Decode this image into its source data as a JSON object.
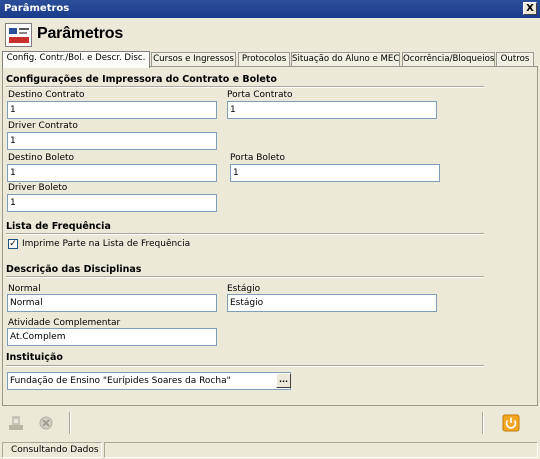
{
  "window": {
    "title": "Parâmetros",
    "close_label": "X"
  },
  "header": {
    "title": "Parâmetros"
  },
  "tabs": [
    {
      "label": "Config. Contr./Bol. e Descr. Disc."
    },
    {
      "label": "Cursos e Ingressos"
    },
    {
      "label": "Protocolos"
    },
    {
      "label": "Situação do Aluno e MEC"
    },
    {
      "label": "Ocorrência/Bloqueios"
    },
    {
      "label": "Outros"
    }
  ],
  "printer": {
    "section_title": "Configurações de Impressora do Contrato e Boleto",
    "destino_contrato": {
      "label": "Destino Contrato",
      "value": "1"
    },
    "porta_contrato": {
      "label": "Porta Contrato",
      "value": "1"
    },
    "driver_contrato": {
      "label": "Driver Contrato",
      "value": "1"
    },
    "destino_boleto": {
      "label": "Destino Boleto",
      "value": "1"
    },
    "porta_boleto": {
      "label": "Porta Boleto",
      "value": "1"
    },
    "driver_boleto": {
      "label": "Driver Boleto",
      "value": "1"
    }
  },
  "frequencia": {
    "section_title": "Lista de Frequência",
    "checkbox_label": "Imprime Parte na Lista de Frequência",
    "checkbox_mark": "✓"
  },
  "disciplinas": {
    "section_title": "Descrição das Disciplinas",
    "normal": {
      "label": "Normal",
      "value": "Normal"
    },
    "estagio": {
      "label": "Estágio",
      "value": "Estágio"
    },
    "atividade": {
      "label": "Atividade Complementar",
      "value": "At.Complem"
    }
  },
  "instituicao": {
    "section_title": "Instituição",
    "value": "Fundação de Ensino \"Eurípides Soares da Rocha\"",
    "lookup_label": "..."
  },
  "toolbar": {
    "icons": [
      "save-icon",
      "cancel-icon",
      "exit-icon"
    ]
  },
  "status": {
    "text": "Consultando Dados"
  }
}
